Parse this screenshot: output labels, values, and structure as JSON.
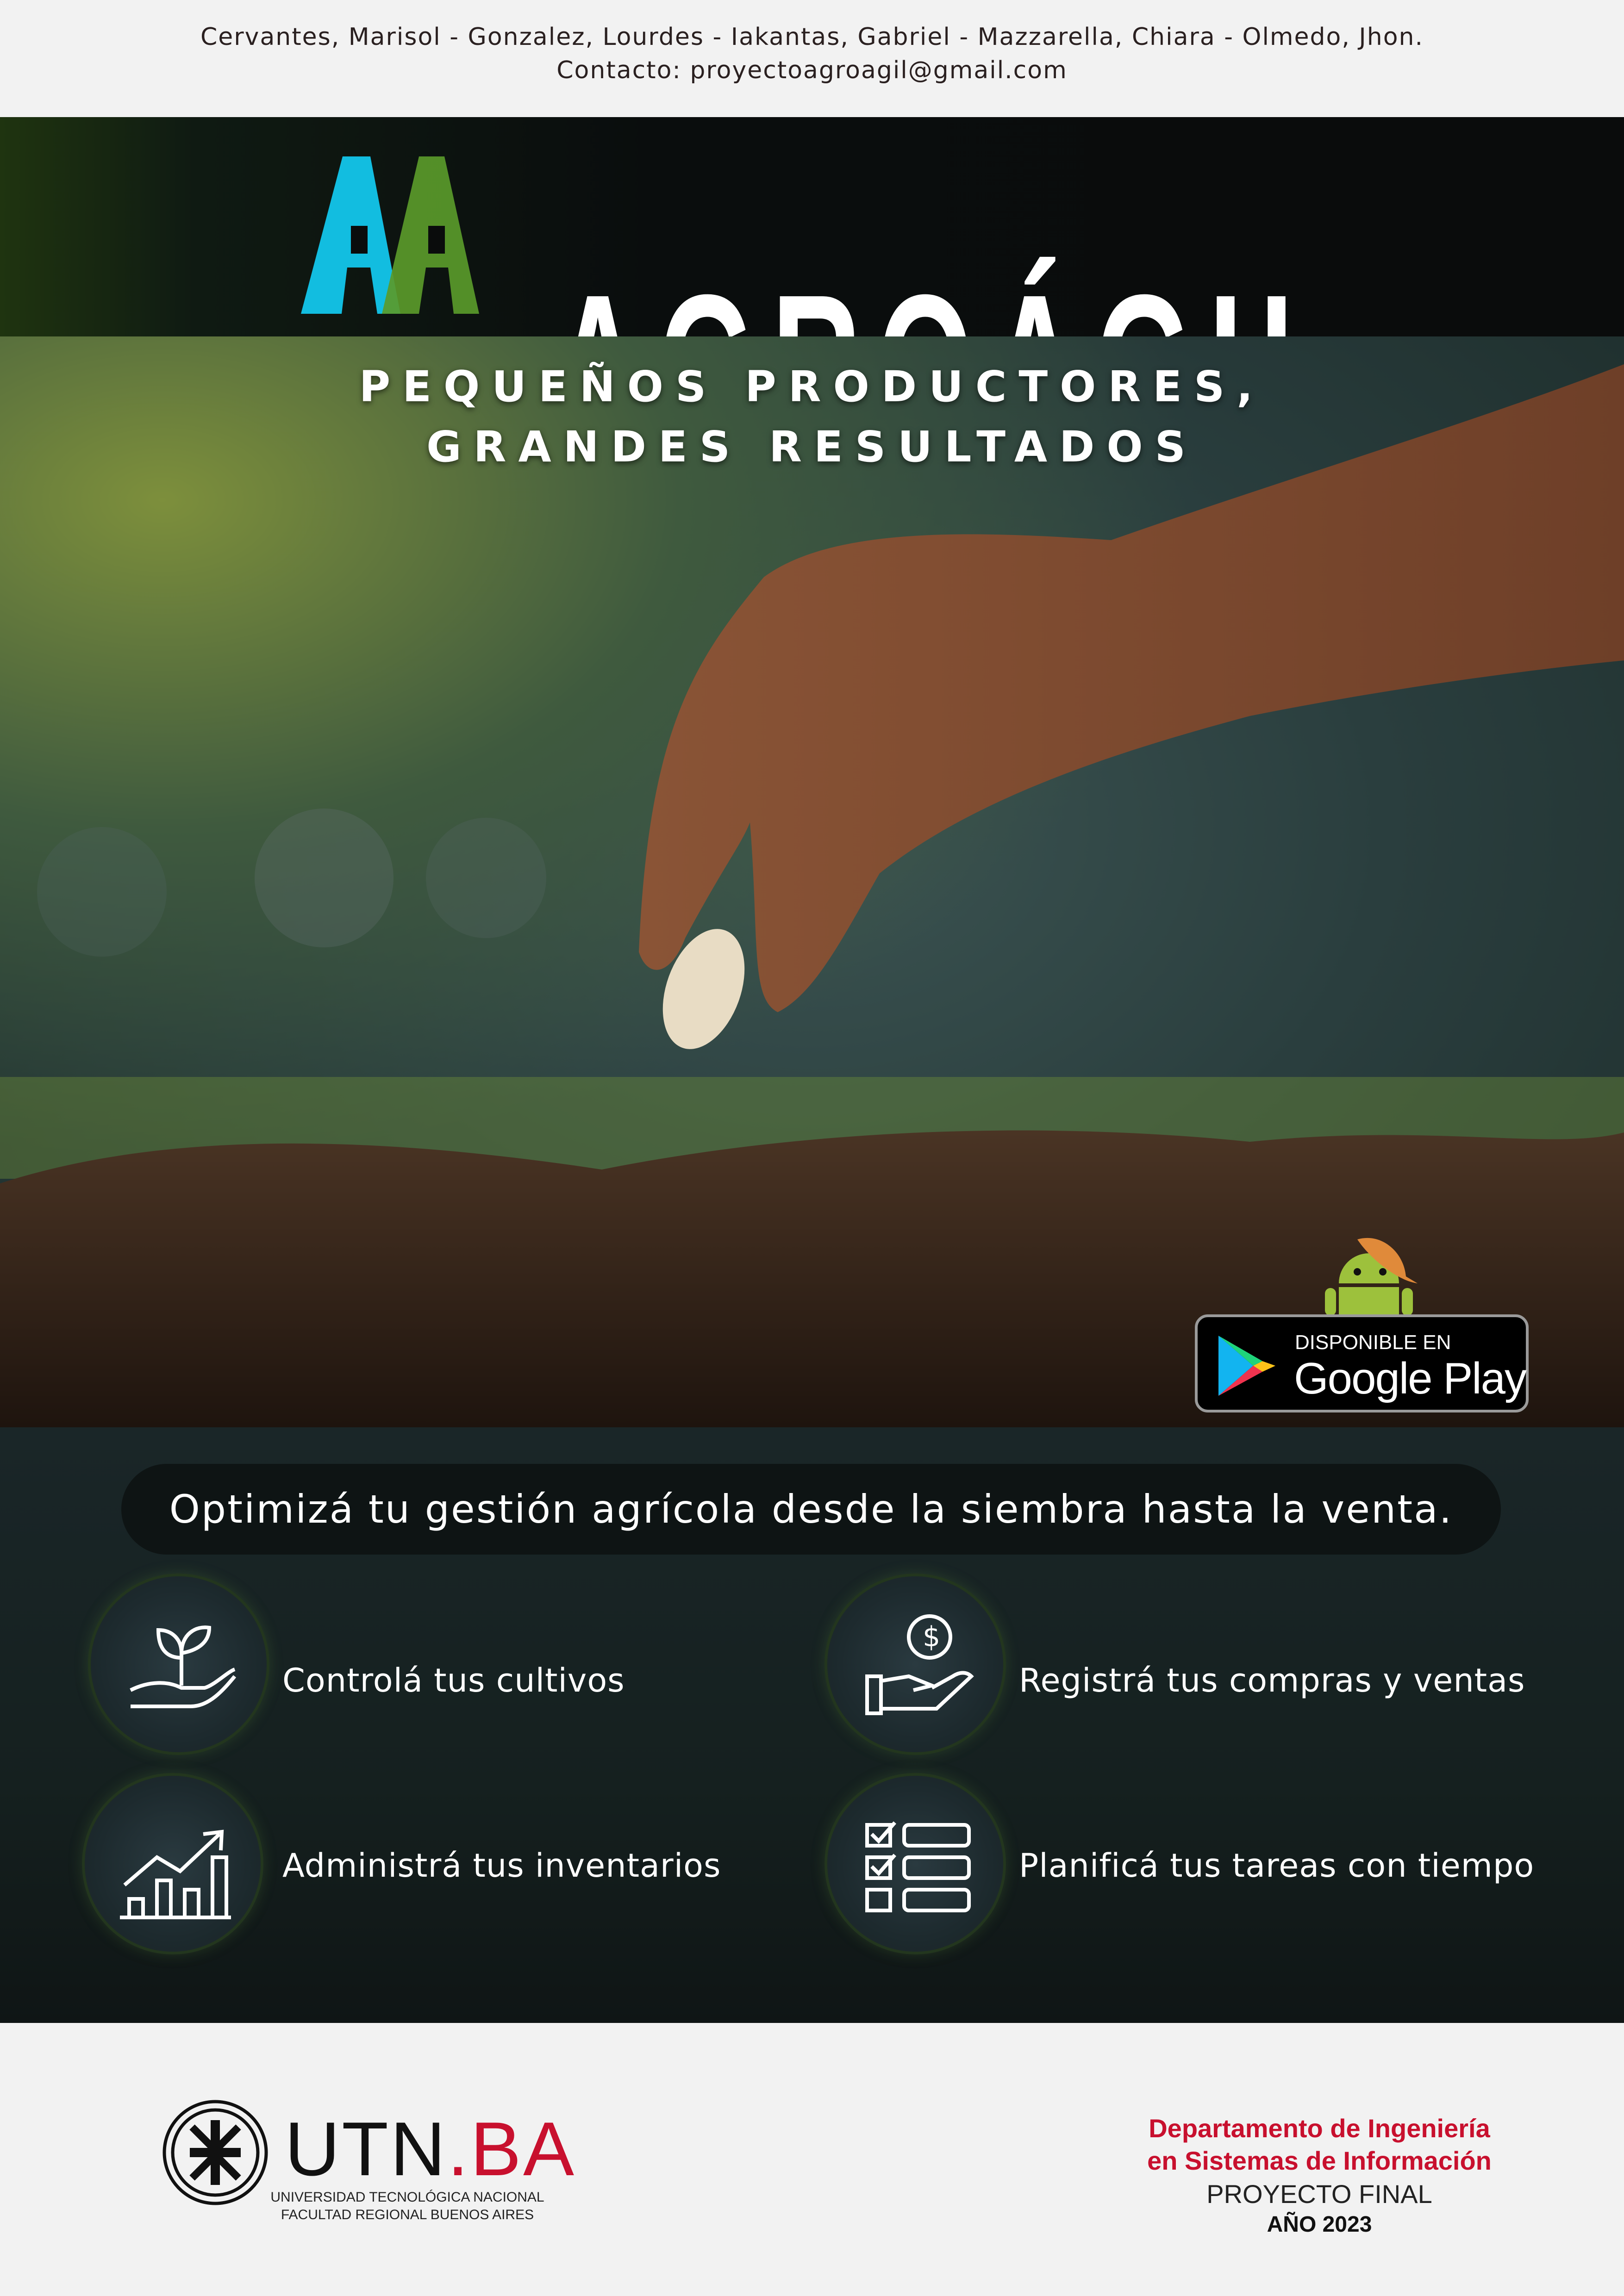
{
  "header": {
    "authors": "Cervantes, Marisol - Gonzalez, Lourdes - Iakantas, Gabriel - Mazzarella, Chiara - Olmedo, Jhon.",
    "contact": "Contacto: proyectoagroagil@gmail.com"
  },
  "brand": {
    "name": "AGROÁGIL",
    "logo_letters": "AA",
    "colors": {
      "blue": "#12bde0",
      "green": "#5a9a2a"
    }
  },
  "hero": {
    "tagline_line1": "PEQUEÑOS PRODUCTORES,",
    "tagline_line2": "GRANDES RESULTADOS"
  },
  "badge": {
    "line1": "DISPONIBLE EN",
    "line2": "Google Play",
    "icon": "google-play-icon",
    "mascot": "android-farmer-icon"
  },
  "features": {
    "headline": "Optimizá tu gestión agrícola desde la siembra hasta la venta.",
    "items": [
      {
        "label": "Controlá tus cultivos",
        "icon": "plant-hand-icon"
      },
      {
        "label": "Registrá tus compras y ventas",
        "icon": "money-hand-icon"
      },
      {
        "label": "Administrá tus inventarios",
        "icon": "growth-chart-icon"
      },
      {
        "label": "Planificá tus tareas con tiempo",
        "icon": "checklist-icon"
      }
    ]
  },
  "footer": {
    "utn_logo": "UTN.BA",
    "utn_line1": "UNIVERSIDAD TECNOLÓGICA NACIONAL",
    "utn_line2": "FACULTAD REGIONAL BUENOS AIRES",
    "dept_line1": "Departamento de Ingeniería",
    "dept_line2": "en Sistemas de Información",
    "project": "PROYECTO FINAL",
    "year": "AÑO 2023",
    "accent": "#c8102e"
  }
}
